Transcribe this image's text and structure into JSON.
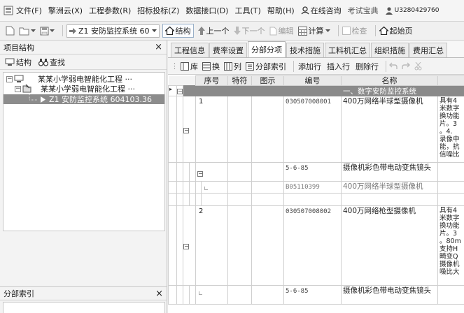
{
  "menubar": {
    "items": [
      {
        "label": "文件(F)"
      },
      {
        "label": "擎洲云(X)"
      },
      {
        "label": "工程参数(R)"
      },
      {
        "label": "招标投标(Z)"
      },
      {
        "label": "数据接口(D)"
      },
      {
        "label": "工具(T)"
      },
      {
        "label": "帮助(H)"
      },
      {
        "label": "在线咨询"
      },
      {
        "label": "考试宝典"
      },
      {
        "label": "U3280429760"
      }
    ]
  },
  "toolbar": {
    "project_combo": "Z1  安防监控系统 60",
    "structure": "结构",
    "prev": "上一个",
    "next": "下一个",
    "edit": "编辑",
    "calculate": "计算",
    "check": "检查",
    "start_page": "起始页"
  },
  "left_panel": {
    "title": "项目结构",
    "structure_btn": "结构",
    "find_btn": "查找",
    "tree": [
      {
        "label": "某某小学弱电智能化工程 ···"
      },
      {
        "label": "某某小学弱电智能化工程 ···"
      },
      {
        "label": "Z1   安防监控系统 604103.36"
      }
    ],
    "index_title": "分部索引"
  },
  "right_panel": {
    "tabs": [
      {
        "label": "工程信息"
      },
      {
        "label": "费率设置"
      },
      {
        "label": "分部分项"
      },
      {
        "label": "技术措施"
      },
      {
        "label": "工料机汇总"
      },
      {
        "label": "组织措施"
      },
      {
        "label": "费用汇总"
      }
    ],
    "subtoolbar": {
      "library": "库",
      "swap": "换",
      "column": "列",
      "division_index": "分部索引",
      "add_row": "添加行",
      "insert_row": "插入行",
      "delete_row": "删除行"
    },
    "grid": {
      "headers": [
        "序号",
        "特符",
        "图示",
        "编号",
        "名称"
      ],
      "section": "一、数字安防监控系统",
      "rows": [
        {
          "seq": "1",
          "code": "030507008001",
          "name": "400万网络半球型摄像机",
          "feature": "具有4\n米数字\n换功能\n片。3\n。4.\n录像中\n能，抗\n信噪比"
        },
        {
          "seq": "",
          "code": "5-6-85",
          "name": "摄像机彩色带电动变焦镜头",
          "feature": ""
        },
        {
          "seq": "",
          "code": "B05110399",
          "name": "400万网络半球型摄像机",
          "feature": ""
        },
        {
          "seq": "2",
          "code": "030507008002",
          "name": "400万网络枪型摄像机",
          "feature": "具有4\n米数字\n换功能\n片。3\n。80m\n支持H\n畸变Q\n摄像机\n噪比大"
        },
        {
          "seq": "",
          "code": "5-6-85",
          "name": "摄像机彩色带电动变焦镜头",
          "feature": ""
        }
      ]
    }
  }
}
